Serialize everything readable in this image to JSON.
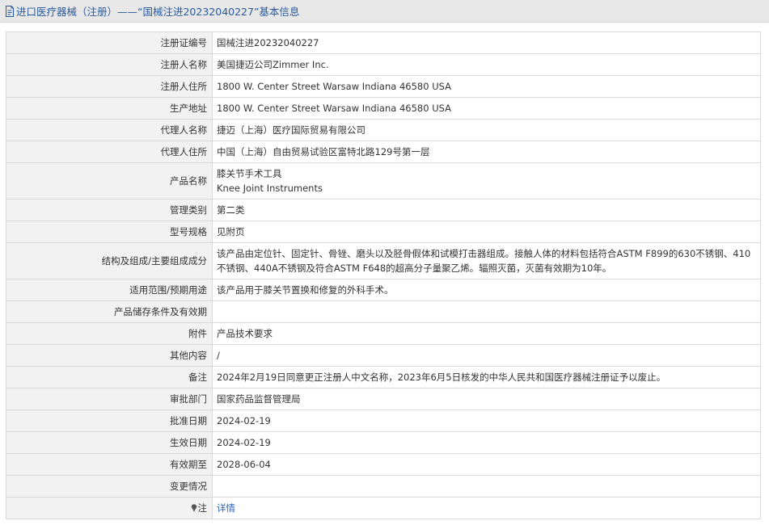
{
  "header": {
    "title": "进口医疗器械（注册）——“国械注进20232040227”基本信息"
  },
  "rows": [
    {
      "label": "注册证编号",
      "lines": [
        "国械注进20232040227"
      ]
    },
    {
      "label": "注册人名称",
      "lines": [
        "美国捷迈公司Zimmer Inc."
      ]
    },
    {
      "label": "注册人住所",
      "lines": [
        "1800 W. Center Street Warsaw Indiana 46580 USA"
      ]
    },
    {
      "label": "生产地址",
      "lines": [
        "1800 W. Center Street Warsaw Indiana 46580 USA"
      ]
    },
    {
      "label": "代理人名称",
      "lines": [
        "捷迈（上海）医疗国际贸易有限公司"
      ]
    },
    {
      "label": "代理人住所",
      "lines": [
        "中国（上海）自由贸易试验区富特北路129号第一层"
      ]
    },
    {
      "label": "产品名称",
      "lines": [
        "膝关节手术工具",
        "Knee Joint Instruments"
      ]
    },
    {
      "label": "管理类别",
      "lines": [
        "第二类"
      ]
    },
    {
      "label": "型号规格",
      "lines": [
        "见附页"
      ]
    },
    {
      "label": "结构及组成/主要组成成分",
      "lines": [
        "该产品由定位针、固定针、骨锉、磨头以及胫骨假体和试模打击器组成。接触人体的材料包括符合ASTM F899的630不锈钢、410不锈钢、440A不锈钢及符合ASTM F648的超高分子量聚乙烯。辐照灭菌，灭菌有效期为10年。"
      ]
    },
    {
      "label": "适用范围/预期用途",
      "lines": [
        "该产品用于膝关节置换和修复的外科手术。"
      ]
    },
    {
      "label": "产品储存条件及有效期",
      "lines": [
        ""
      ]
    },
    {
      "label": "附件",
      "lines": [
        "产品技术要求"
      ]
    },
    {
      "label": "其他内容",
      "lines": [
        "/"
      ]
    },
    {
      "label": "备注",
      "lines": [
        "2024年2月19日同意更正注册人中文名称，2023年6月5日核发的中华人民共和国医疗器械注册证予以废止。"
      ]
    },
    {
      "label": "审批部门",
      "lines": [
        "国家药品监督管理局"
      ]
    },
    {
      "label": "批准日期",
      "lines": [
        "2024-02-19"
      ]
    },
    {
      "label": "生效日期",
      "lines": [
        "2024-02-19"
      ]
    },
    {
      "label": "有效期至",
      "lines": [
        "2028-06-04"
      ]
    },
    {
      "label": "变更情况",
      "lines": [
        ""
      ]
    }
  ],
  "note_row": {
    "label": "注",
    "icon": "pin-icon",
    "link_text": "详情"
  },
  "colors": {
    "title_text": "#2a5a9c",
    "label_bg": "#f2f2f2",
    "border": "#d9d9d9",
    "link": "#2a64b8"
  }
}
